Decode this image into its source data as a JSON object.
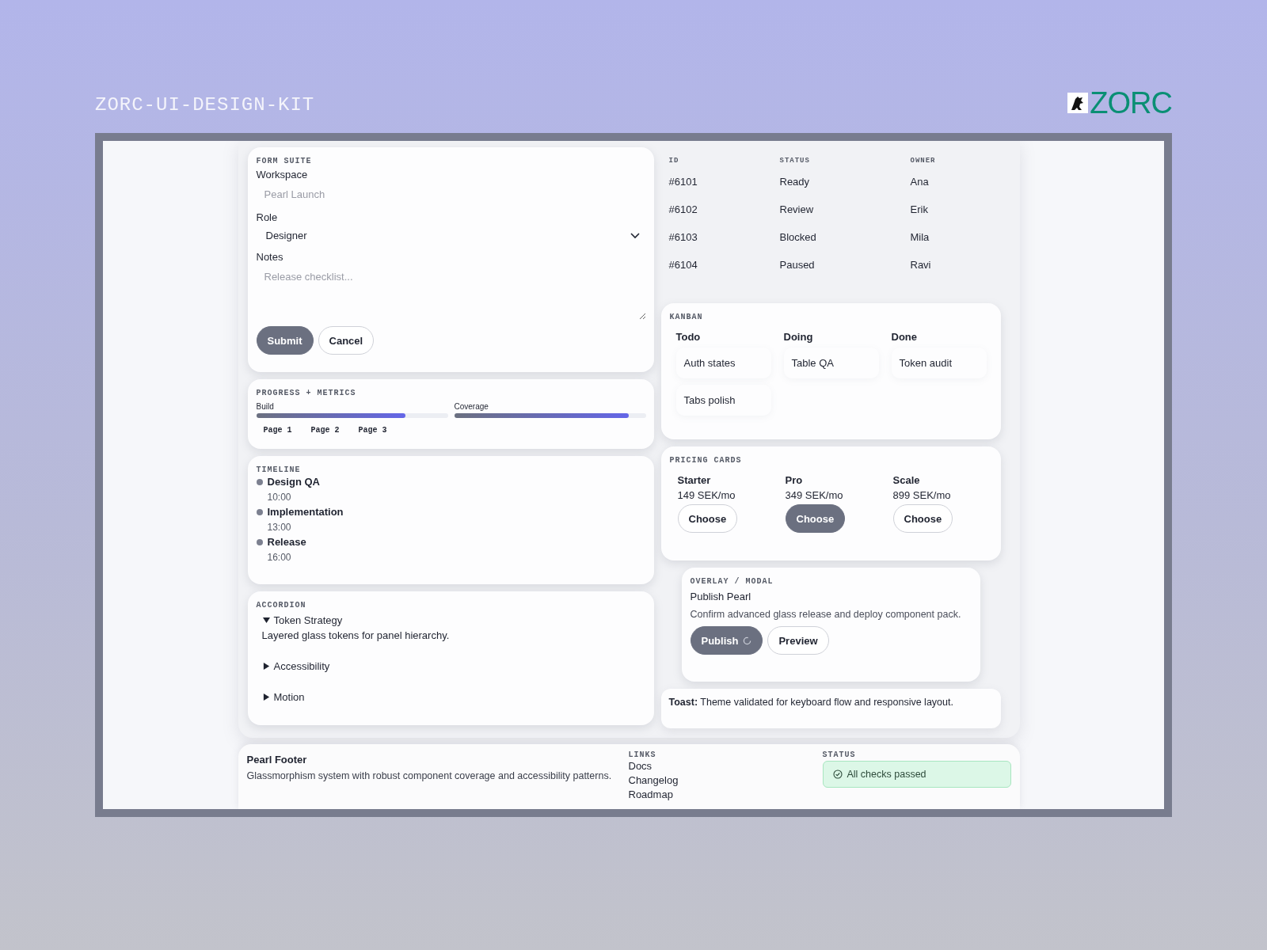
{
  "header": {
    "title": "ZORC-UI-DESIGN-KIT",
    "logo_text": "ZORC"
  },
  "form": {
    "title": "FORM SUITE",
    "fields": [
      {
        "kind": "text",
        "label": "Workspace",
        "placeholder": "Pearl Launch"
      },
      {
        "kind": "select",
        "label": "Role",
        "value": "Designer"
      },
      {
        "kind": "textarea",
        "label": "Notes",
        "placeholder": "Release checklist..."
      }
    ],
    "buttons": [
      {
        "label": "Submit",
        "primary": true
      },
      {
        "label": "Cancel",
        "primary": false
      }
    ]
  },
  "progress": {
    "title": "PROGRESS + METRICS",
    "meters": [
      {
        "label": "Build",
        "level": 0.78
      },
      {
        "label": "Coverage",
        "level": 0.91
      }
    ],
    "pages": [
      "Page 1",
      "Page 2",
      "Page 3"
    ]
  },
  "timeline": {
    "title": "TIMELINE",
    "events": [
      {
        "title": "Design QA",
        "time": "10:00"
      },
      {
        "title": "Implementation",
        "time": "13:00"
      },
      {
        "title": "Release",
        "time": "16:00"
      }
    ]
  },
  "accordion": {
    "title": "ACCORDION",
    "items": [
      {
        "title": "Token Strategy",
        "expanded": true,
        "body": "Layered glass tokens for panel hierarchy."
      },
      {
        "title": "Accessibility",
        "expanded": false
      },
      {
        "title": "Motion",
        "expanded": false
      }
    ]
  },
  "table": {
    "columns": [
      "ID",
      "STATUS",
      "OWNER"
    ],
    "rows": [
      [
        "#6101",
        "Ready",
        "Ana"
      ],
      [
        "#6102",
        "Review",
        "Erik"
      ],
      [
        "#6103",
        "Blocked",
        "Mila"
      ],
      [
        "#6104",
        "Paused",
        "Ravi"
      ]
    ]
  },
  "kanban": {
    "title": "KANBAN",
    "columns": [
      {
        "title": "Todo",
        "cards": [
          "Auth states",
          "Tabs polish"
        ]
      },
      {
        "title": "Doing",
        "cards": [
          "Table QA"
        ]
      },
      {
        "title": "Done",
        "cards": [
          "Token audit"
        ]
      }
    ]
  },
  "pricing": {
    "title": "PRICING CARDS",
    "plans": [
      {
        "name": "Starter",
        "price": "149 SEK/mo",
        "button": "Choose",
        "selected": false
      },
      {
        "name": "Pro",
        "price": "349 SEK/mo",
        "button": "Choose",
        "selected": true
      },
      {
        "name": "Scale",
        "price": "899 SEK/mo",
        "button": "Choose",
        "selected": false
      }
    ]
  },
  "modal": {
    "title": "OVERLAY / MODAL",
    "heading": "Publish Pearl",
    "text": "Confirm advanced glass release and deploy component pack.",
    "buttons": [
      {
        "label": "Publish",
        "primary": true,
        "loading": true
      },
      {
        "label": "Preview",
        "primary": false,
        "loading": false
      }
    ]
  },
  "toast": {
    "label": "Toast:",
    "text": "Theme validated for keyboard flow and responsive layout."
  },
  "footer": {
    "title": "Pearl Footer",
    "text": "Glassmorphism system with robust component coverage and accessibility patterns.",
    "links_title": "LINKS",
    "links": [
      "Docs",
      "Changelog",
      "Roadmap"
    ],
    "status_title": "STATUS",
    "status": "All checks passed"
  }
}
